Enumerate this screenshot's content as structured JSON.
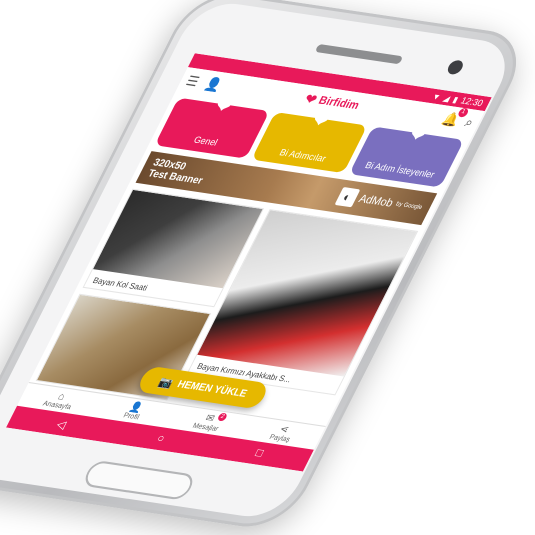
{
  "status": {
    "time": "12:30",
    "wifi_icon": "wifi-icon",
    "battery_icon": "battery-icon"
  },
  "app_bar": {
    "logo_text": "Birfidim",
    "notification_count": "1"
  },
  "categories": [
    {
      "label": "Genel",
      "color": "#e8195a"
    },
    {
      "label": "Bi Adımcılar",
      "color": "#e6b800"
    },
    {
      "label": "Bi Adım İsteyenler",
      "color": "#7a6fbf"
    }
  ],
  "banner": {
    "text": "320x50\nTest Banner",
    "ad_label": "AdMob",
    "ad_sub": "by Google"
  },
  "products": [
    {
      "label": "Bayan Kol Saati"
    },
    {
      "label": "Bayan Kırmızı Ayakkabı S..."
    },
    {
      "label": ""
    }
  ],
  "fab": {
    "label": "HEMEN YÜKLE"
  },
  "bottom_nav": [
    {
      "label": "Anasayfa",
      "icon": "home-icon"
    },
    {
      "label": "Profil",
      "icon": "profile-icon"
    },
    {
      "label": "Mesajlar",
      "icon": "messages-icon",
      "badge": "2"
    },
    {
      "label": "Paylaş",
      "icon": "share-icon"
    }
  ],
  "colors": {
    "primary": "#e8195a",
    "accent": "#e6b800",
    "secondary": "#7a6fbf"
  }
}
